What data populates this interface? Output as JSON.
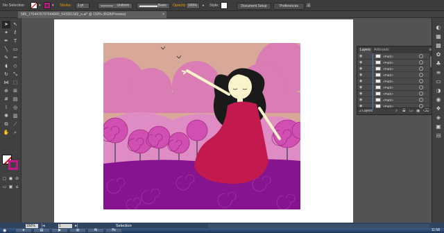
{
  "control_bar": {
    "selection_label": "No Selection",
    "stroke_label": "Stroke:",
    "stroke_weight": "1 pt",
    "profile_value": "Uniform",
    "brush_value": "Basic",
    "opacity_label": "Opacity:",
    "opacity_value": "100%",
    "style_label": "Style:",
    "document_setup_label": "Document Setup",
    "preferences_label": "Preferences",
    "fill_color": "#ffffff",
    "stroke_color": "#c2188a"
  },
  "document_tab": {
    "title": "585_1704476797644990_543261582_n.ai* @ 150% (RGB/Preview)",
    "close_icon": "×"
  },
  "tools": [
    {
      "name": "selection-tool-icon",
      "glyph": "➤"
    },
    {
      "name": "direct-selection-tool-icon",
      "glyph": "↖"
    },
    {
      "name": "magic-wand-tool-icon",
      "glyph": "✦"
    },
    {
      "name": "lasso-tool-icon",
      "glyph": "ℓ"
    },
    {
      "name": "pen-tool-icon",
      "glyph": "✒"
    },
    {
      "name": "type-tool-icon",
      "glyph": "T"
    },
    {
      "name": "line-tool-icon",
      "glyph": "╲"
    },
    {
      "name": "rectangle-tool-icon",
      "glyph": "▭"
    },
    {
      "name": "paintbrush-tool-icon",
      "glyph": "✎"
    },
    {
      "name": "pencil-tool-icon",
      "glyph": "✏"
    },
    {
      "name": "blob-brush-tool-icon",
      "glyph": "◖"
    },
    {
      "name": "eraser-tool-icon",
      "glyph": "◇"
    },
    {
      "name": "rotate-tool-icon",
      "glyph": "↻"
    },
    {
      "name": "scale-tool-icon",
      "glyph": "⤡"
    },
    {
      "name": "width-tool-icon",
      "glyph": "⋈"
    },
    {
      "name": "free-transform-tool-icon",
      "glyph": "⬚"
    },
    {
      "name": "shape-builder-tool-icon",
      "glyph": "⊕"
    },
    {
      "name": "perspective-grid-tool-icon",
      "glyph": "⊞"
    },
    {
      "name": "mesh-tool-icon",
      "glyph": "#"
    },
    {
      "name": "gradient-tool-icon",
      "glyph": "▤"
    },
    {
      "name": "eyedropper-tool-icon",
      "glyph": "⌇"
    },
    {
      "name": "blend-tool-icon",
      "glyph": "◎"
    },
    {
      "name": "symbol-sprayer-tool-icon",
      "glyph": "✺"
    },
    {
      "name": "column-graph-tool-icon",
      "glyph": "▥"
    },
    {
      "name": "artboard-tool-icon",
      "glyph": "⧉"
    },
    {
      "name": "slice-tool-icon",
      "glyph": "⟋"
    },
    {
      "name": "hand-tool-icon",
      "glyph": "✋"
    },
    {
      "name": "zoom-tool-icon",
      "glyph": "⌕"
    }
  ],
  "dock_icons": [
    {
      "name": "color-panel-icon",
      "glyph": "◐"
    },
    {
      "name": "color-guide-icon",
      "glyph": "▦"
    },
    {
      "name": "swatches-icon",
      "glyph": "▩"
    },
    {
      "name": "brushes-icon",
      "glyph": "✿"
    },
    {
      "name": "symbols-icon",
      "glyph": "♣"
    },
    {
      "name": "stroke-panel-icon",
      "glyph": "≡"
    },
    {
      "name": "gradient-panel-icon",
      "glyph": "▭"
    },
    {
      "name": "transparency-panel-icon",
      "glyph": "◑"
    },
    {
      "name": "appearance-panel-icon",
      "glyph": "◉"
    },
    {
      "name": "graphic-styles-icon",
      "glyph": "❖"
    },
    {
      "name": "layers-panel-icon",
      "glyph": "◈"
    },
    {
      "name": "artboards-panel-icon",
      "glyph": "▣"
    },
    {
      "name": "align-panel-icon",
      "glyph": "⊟"
    }
  ],
  "layers_panel": {
    "tabs": [
      "Layers",
      "Artboards"
    ],
    "rows": [
      "<Path>",
      "<Path>",
      "<Path>",
      "<Path>",
      "<Path>",
      "<Path>",
      "<Path>",
      "<Path>",
      "<Path>"
    ],
    "footer": "2 Layers",
    "eye_icon": "◉"
  },
  "status_bar": {
    "zoom": "150%",
    "page": "1",
    "status_text": "Selection",
    "clock": "11:58"
  },
  "taskbar": {
    "start_icon": "◉",
    "apps": [
      {
        "name": "ie-icon",
        "glyph": "e"
      },
      {
        "name": "explorer-icon",
        "glyph": "▤"
      },
      {
        "name": "media-icon",
        "glyph": "▶"
      },
      {
        "name": "chrome-icon",
        "glyph": "◍"
      },
      {
        "name": "illustrator-icon",
        "glyph": "Ai"
      },
      {
        "name": "photoshop-icon",
        "glyph": "Ps"
      }
    ]
  },
  "colors": {
    "sky": "#d8a898",
    "pink_sky": "#d97db4",
    "hills": "#e08cc4",
    "ground": "#86148f",
    "dress": "#c21a4e",
    "hair": "#1a1a1a",
    "skin": "#fbf3cc",
    "tree": "#d24fb2"
  }
}
